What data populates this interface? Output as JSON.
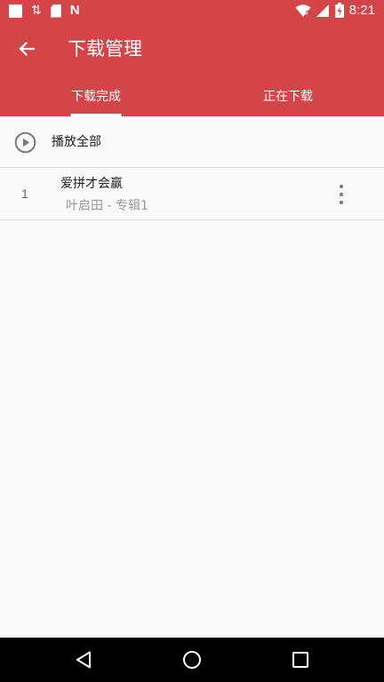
{
  "status_bar": {
    "time": "8:21",
    "left_icons": [
      "notification-square-icon",
      "data-transfer-icon",
      "sd-card-icon",
      "n-app-icon"
    ],
    "right_icons": [
      "wifi-icon",
      "signal-icon",
      "battery-charging-icon"
    ],
    "color": "#d4454a"
  },
  "app_bar": {
    "title": "下载管理",
    "back_icon": "arrow-left-icon",
    "color": "#d4454a"
  },
  "tabs": [
    {
      "label": "下载完成",
      "selected": true
    },
    {
      "label": "正在下载",
      "selected": false
    }
  ],
  "play_all": {
    "icon": "play-circle-icon",
    "label": "播放全部"
  },
  "songs": [
    {
      "index": "1",
      "title": "爱拼才会赢",
      "subtitle": "叶启田 - 专辑1",
      "menu_icon": "more-vertical-icon"
    }
  ],
  "nav_bar": {
    "icons": [
      "nav-back-icon",
      "nav-home-icon",
      "nav-recents-icon"
    ]
  }
}
